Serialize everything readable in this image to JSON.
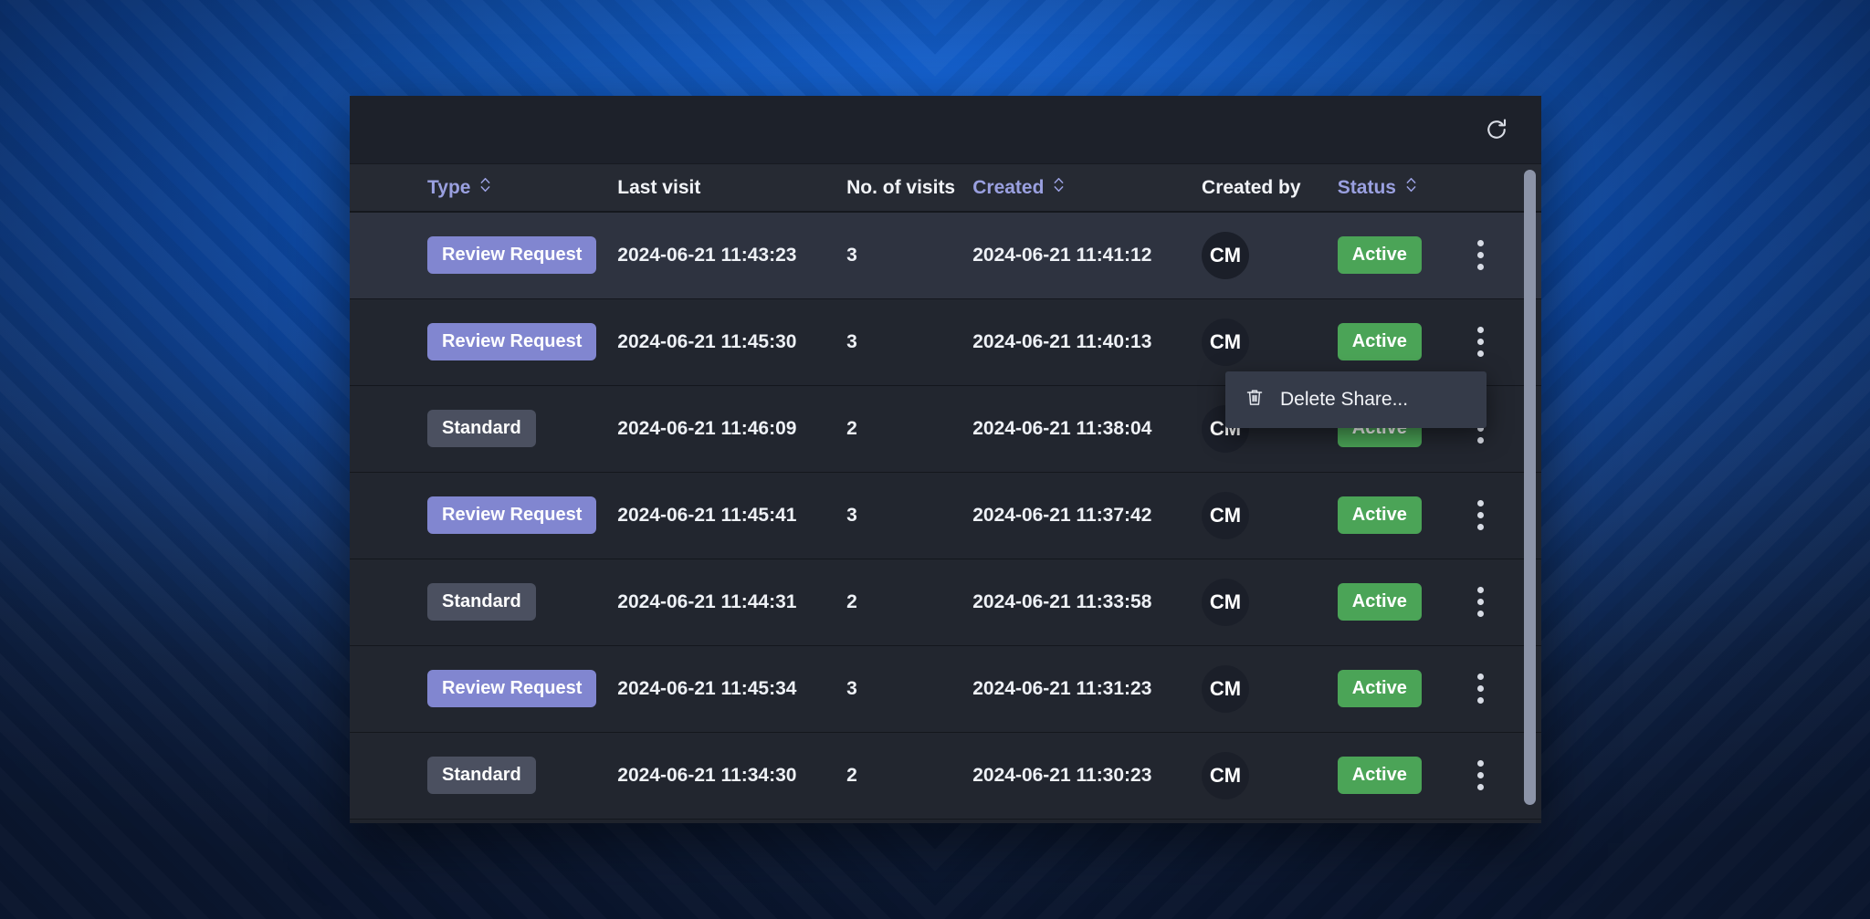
{
  "window": {
    "toolbar": {
      "refresh_icon": "refresh-icon"
    }
  },
  "table": {
    "columns": [
      {
        "key": "type",
        "label": "Type",
        "sortable": true,
        "accent": "#9aa0e0"
      },
      {
        "key": "last_visit",
        "label": "Last visit",
        "sortable": false,
        "accent": "#f2f4f8"
      },
      {
        "key": "num_visits",
        "label": "No. of visits",
        "sortable": false,
        "accent": "#f2f4f8"
      },
      {
        "key": "created",
        "label": "Created",
        "sortable": true,
        "accent": "#9aa0e0"
      },
      {
        "key": "created_by",
        "label": "Created by",
        "sortable": false,
        "accent": "#f2f4f8"
      },
      {
        "key": "status",
        "label": "Status",
        "sortable": true,
        "accent": "#9aa0e0"
      }
    ],
    "rows": [
      {
        "type": "Review Request",
        "type_variant": "review",
        "last_visit": "2024-06-21 11:43:23",
        "num_visits": "3",
        "created": "2024-06-21 11:41:12",
        "created_by": "CM",
        "status": "Active",
        "highlighted": true
      },
      {
        "type": "Review Request",
        "type_variant": "review",
        "last_visit": "2024-06-21 11:45:30",
        "num_visits": "3",
        "created": "2024-06-21 11:40:13",
        "created_by": "CM",
        "status": "Active",
        "highlighted": false
      },
      {
        "type": "Standard",
        "type_variant": "standard",
        "last_visit": "2024-06-21 11:46:09",
        "num_visits": "2",
        "created": "2024-06-21 11:38:04",
        "created_by": "CM",
        "status": "Active",
        "highlighted": false
      },
      {
        "type": "Review Request",
        "type_variant": "review",
        "last_visit": "2024-06-21 11:45:41",
        "num_visits": "3",
        "created": "2024-06-21 11:37:42",
        "created_by": "CM",
        "status": "Active",
        "highlighted": false
      },
      {
        "type": "Standard",
        "type_variant": "standard",
        "last_visit": "2024-06-21 11:44:31",
        "num_visits": "2",
        "created": "2024-06-21 11:33:58",
        "created_by": "CM",
        "status": "Active",
        "highlighted": false
      },
      {
        "type": "Review Request",
        "type_variant": "review",
        "last_visit": "2024-06-21 11:45:34",
        "num_visits": "3",
        "created": "2024-06-21 11:31:23",
        "created_by": "CM",
        "status": "Active",
        "highlighted": false
      },
      {
        "type": "Standard",
        "type_variant": "standard",
        "last_visit": "2024-06-21 11:34:30",
        "num_visits": "2",
        "created": "2024-06-21 11:30:23",
        "created_by": "CM",
        "status": "Active",
        "highlighted": false
      }
    ]
  },
  "context_menu": {
    "items": [
      {
        "label": "Delete Share...",
        "icon": "trash-icon"
      }
    ]
  },
  "colors": {
    "badge_review": "#8186d0",
    "badge_standard": "#4b5060",
    "badge_active": "#4ba457",
    "header_accent": "#9aa0e0",
    "row_bg": "#22262f",
    "row_bg_highlighted": "#2e3340",
    "window_bg": "#1b1f27",
    "scrollbar_thumb": "#8c94a8",
    "desktop_accent": "#0d47a1"
  }
}
